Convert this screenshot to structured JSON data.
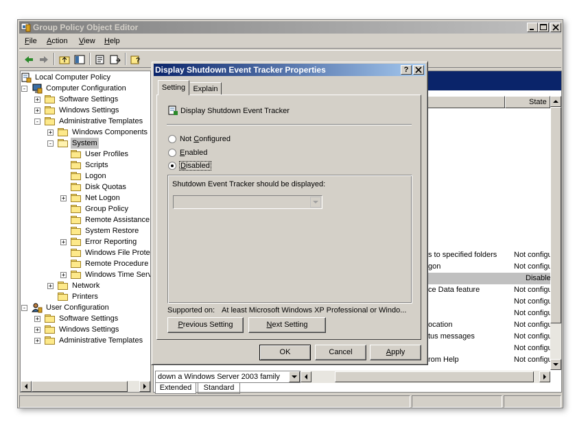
{
  "main_window": {
    "title": "Group Policy Object Editor",
    "menu": [
      "File",
      "Action",
      "View",
      "Help"
    ],
    "menu_accel": [
      "F",
      "A",
      "V",
      "H"
    ]
  },
  "tree": {
    "items": [
      {
        "label": "Local Computer Policy"
      },
      {
        "label": "Computer Configuration"
      },
      {
        "label": "Software Settings"
      },
      {
        "label": "Windows Settings"
      },
      {
        "label": "Administrative Templates"
      },
      {
        "label": "Windows Components"
      },
      {
        "label": "System"
      },
      {
        "label": "User Profiles"
      },
      {
        "label": "Scripts"
      },
      {
        "label": "Logon"
      },
      {
        "label": "Disk Quotas"
      },
      {
        "label": "Net Logon"
      },
      {
        "label": "Group Policy"
      },
      {
        "label": "Remote Assistance"
      },
      {
        "label": "System Restore"
      },
      {
        "label": "Error Reporting"
      },
      {
        "label": "Windows File Protec"
      },
      {
        "label": "Remote Procedure C"
      },
      {
        "label": "Windows Time Serv"
      },
      {
        "label": "Network"
      },
      {
        "label": "Printers"
      },
      {
        "label": "User Configuration"
      },
      {
        "label": "Software Settings"
      },
      {
        "label": "Windows Settings"
      },
      {
        "label": "Administrative Templates"
      }
    ]
  },
  "right_pane": {
    "state_header": "State",
    "rows": [
      {
        "setting": "s to specified folders",
        "state": "Not configu"
      },
      {
        "setting": "gon",
        "state": "Not configu"
      },
      {
        "setting": "",
        "state": "Disabled"
      },
      {
        "setting": "ce Data feature",
        "state": "Not configu"
      },
      {
        "setting": "",
        "state": "Not configu"
      },
      {
        "setting": "",
        "state": "Not configu"
      },
      {
        "setting": "ocation",
        "state": "Not configu"
      },
      {
        "setting": "tus messages",
        "state": "Not configu"
      },
      {
        "setting": "",
        "state": "Not configu"
      },
      {
        "setting": "rom Help",
        "state": "Not configu"
      }
    ],
    "bottom_combo": "down a Windows Server 2003 family",
    "tabs": [
      "Extended",
      "Standard"
    ]
  },
  "dialog": {
    "title": "Display Shutdown Event Tracker Properties",
    "tabs": [
      "Setting",
      "Explain"
    ],
    "policy_name": "Display Shutdown Event Tracker",
    "options": {
      "not_configured": "Not Configured",
      "enabled": "Enabled",
      "disabled": "Disabled",
      "selected": "disabled"
    },
    "group_label": "Shutdown Event Tracker should be displayed:",
    "supported_label": "Supported on:",
    "supported_value": "At least Microsoft Windows XP Professional or Windo...",
    "prev_button": "Previous Setting",
    "next_button": "Next Setting",
    "ok_button": "OK",
    "cancel_button": "Cancel",
    "apply_button": "Apply"
  },
  "colors": {
    "title_active": "#0a246a",
    "title_inactive": "#808080",
    "selection": "#c0c0c0",
    "face": "#d4d0c8"
  }
}
